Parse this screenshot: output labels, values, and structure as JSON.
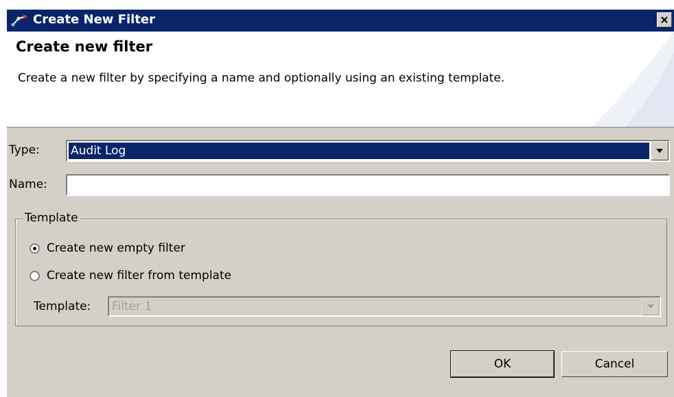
{
  "window": {
    "title": "Create New Filter"
  },
  "banner": {
    "title": "Create new filter",
    "description": "Create a new filter by specifying a name and optionally using an existing template."
  },
  "form": {
    "type_label": "Type:",
    "type_value": "Audit Log",
    "name_label": "Name:",
    "name_value": "",
    "name_placeholder": ""
  },
  "template_group": {
    "label": "Template",
    "options": [
      {
        "label": "Create new empty filter",
        "selected": true
      },
      {
        "label": "Create new filter from template",
        "selected": false
      }
    ],
    "template_label": "Template:",
    "template_value": "Filter 1"
  },
  "buttons": {
    "ok": "OK",
    "cancel": "Cancel"
  },
  "colors": {
    "titlebar": "#0a246a",
    "dialog_bg": "#d4d0c8",
    "selection": "#0a246a"
  }
}
